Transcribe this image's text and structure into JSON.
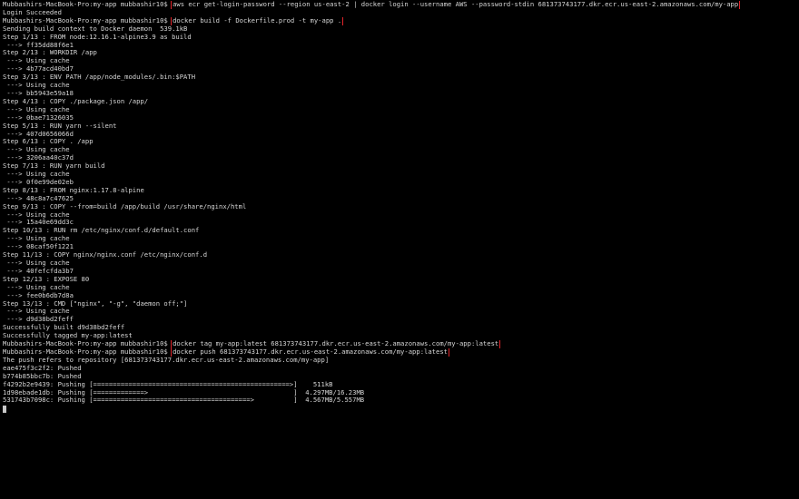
{
  "terminal": {
    "prompt": "Mubbashirs-MacBook-Pro:my-app mubbashir10$ ",
    "lines": [
      {
        "type": "cmd",
        "text": "aws ecr get-login-password --region us-east-2 | docker login --username AWS --password-stdin 681373743177.dkr.ecr.us-east-2.amazonaws.com/my-app"
      },
      {
        "type": "out",
        "text": "Login Succeeded"
      },
      {
        "type": "cmd",
        "text": "docker build -f Dockerfile.prod -t my-app ."
      },
      {
        "type": "out",
        "text": "Sending build context to Docker daemon  539.1kB"
      },
      {
        "type": "out",
        "text": "Step 1/13 : FROM node:12.16.1-alpine3.9 as build"
      },
      {
        "type": "out",
        "text": " ---> ff35dd88f6e1"
      },
      {
        "type": "out",
        "text": "Step 2/13 : WORKDIR /app"
      },
      {
        "type": "out",
        "text": " ---> Using cache"
      },
      {
        "type": "out",
        "text": " ---> 4b77acd40bd7"
      },
      {
        "type": "out",
        "text": "Step 3/13 : ENV PATH /app/node_modules/.bin:$PATH"
      },
      {
        "type": "out",
        "text": " ---> Using cache"
      },
      {
        "type": "out",
        "text": " ---> bb5943e59a18"
      },
      {
        "type": "out",
        "text": "Step 4/13 : COPY ./package.json /app/"
      },
      {
        "type": "out",
        "text": " ---> Using cache"
      },
      {
        "type": "out",
        "text": " ---> 0bae71326035"
      },
      {
        "type": "out",
        "text": "Step 5/13 : RUN yarn --silent"
      },
      {
        "type": "out",
        "text": " ---> 407d0656066d"
      },
      {
        "type": "out",
        "text": "Step 6/13 : COPY . /app"
      },
      {
        "type": "out",
        "text": " ---> Using cache"
      },
      {
        "type": "out",
        "text": " ---> 3206aa40c37d"
      },
      {
        "type": "out",
        "text": "Step 7/13 : RUN yarn build"
      },
      {
        "type": "out",
        "text": " ---> Using cache"
      },
      {
        "type": "out",
        "text": " ---> 0f0e99de02eb"
      },
      {
        "type": "out",
        "text": "Step 8/13 : FROM nginx:1.17.8-alpine"
      },
      {
        "type": "out",
        "text": " ---> 48c8a7c47625"
      },
      {
        "type": "out",
        "text": "Step 9/13 : COPY --from=build /app/build /usr/share/nginx/html"
      },
      {
        "type": "out",
        "text": " ---> Using cache"
      },
      {
        "type": "out",
        "text": " ---> 15a40e69dd3c"
      },
      {
        "type": "out",
        "text": "Step 10/13 : RUN rm /etc/nginx/conf.d/default.conf"
      },
      {
        "type": "out",
        "text": " ---> Using cache"
      },
      {
        "type": "out",
        "text": " ---> 08caf50f1221"
      },
      {
        "type": "out",
        "text": "Step 11/13 : COPY nginx/nginx.conf /etc/nginx/conf.d"
      },
      {
        "type": "out",
        "text": " ---> Using cache"
      },
      {
        "type": "out",
        "text": " ---> 40fefcfda3b7"
      },
      {
        "type": "out",
        "text": "Step 12/13 : EXPOSE 80"
      },
      {
        "type": "out",
        "text": " ---> Using cache"
      },
      {
        "type": "out",
        "text": " ---> fee0b6db7d8a"
      },
      {
        "type": "out",
        "text": "Step 13/13 : CMD [\"nginx\", \"-g\", \"daemon off;\"]"
      },
      {
        "type": "out",
        "text": " ---> Using cache"
      },
      {
        "type": "out",
        "text": " ---> d9d38bd2feff"
      },
      {
        "type": "out",
        "text": "Successfully built d9d38bd2feff"
      },
      {
        "type": "out",
        "text": "Successfully tagged my-app:latest"
      },
      {
        "type": "cmd",
        "text": "docker tag my-app:latest 681373743177.dkr.ecr.us-east-2.amazonaws.com/my-app:latest"
      },
      {
        "type": "cmd",
        "text": "docker push 681373743177.dkr.ecr.us-east-2.amazonaws.com/my-app:latest"
      },
      {
        "type": "out",
        "text": "The push refers to repository [681373743177.dkr.ecr.us-east-2.amazonaws.com/my-app]"
      },
      {
        "type": "out",
        "text": "eae475f3c2f2: Pushed"
      },
      {
        "type": "out",
        "text": "b774b85bbc7b: Pushed"
      },
      {
        "type": "out",
        "text": "f4292b2e9439: Pushing [==================================================>]    511kB"
      },
      {
        "type": "out",
        "text": "1d98ebade1db: Pushing [=============>                                     ]  4.297MB/16.23MB"
      },
      {
        "type": "out",
        "text": "531743b7098c: Pushing [========================================>          ]  4.567MB/5.557MB"
      }
    ]
  },
  "colors": {
    "background": "#000000",
    "text": "#d6d6d6",
    "highlight_box": "#e0242a"
  }
}
